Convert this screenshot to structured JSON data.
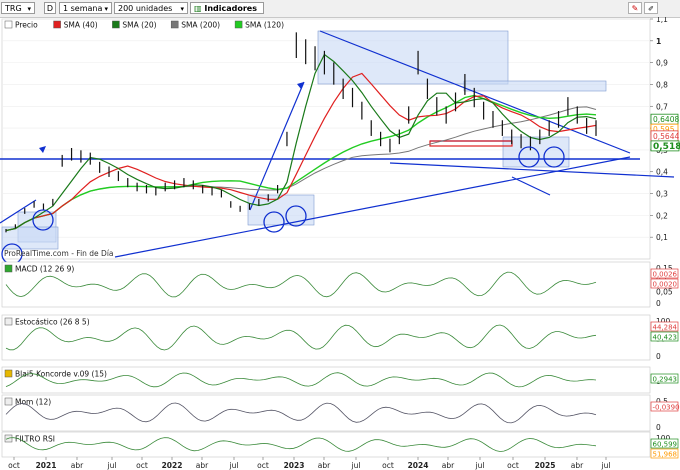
{
  "toolbar": {
    "ticker": "TRG",
    "ticker_icon": "chevron-down-icon",
    "d_button": "D",
    "timeframe": "1 semana",
    "units": "200 unidades",
    "indicators": "Indicadores"
  },
  "colors": {
    "sma40": "#e02020",
    "sma20": "#1a7a1a",
    "sma200": "#777777",
    "sma120": "#22cc22",
    "trend": "#1030d0",
    "box": "#9bb6e8",
    "macd_pos": "#2fa82f",
    "macd_neg": "#d03030",
    "tag_red": "#e04040",
    "tag_orange": "#ff9900",
    "tag_green": "#1e8e1e"
  },
  "chart_data": {
    "type": "line",
    "title": "",
    "price_axis": {
      "min": 0,
      "max": 1.1,
      "ticks": [
        "1,1",
        "1",
        "0,9",
        "0,8",
        "0,7",
        "0,6",
        "0,5",
        "0,4",
        "0,3",
        "0,2",
        "0,1"
      ]
    },
    "price_tags": [
      {
        "label": "0,6408",
        "value": 0.6408,
        "color": "tag_green"
      },
      {
        "label": "0,595",
        "value": 0.595,
        "color": "tag_orange"
      },
      {
        "label": "0,5644",
        "value": 0.5644,
        "color": "tag_red"
      },
      {
        "label": "0,5184",
        "value": 0.5184,
        "color": "tag_green"
      }
    ],
    "legend": [
      {
        "label": "Precio",
        "color": "#ffffff"
      },
      {
        "label": "SMA (40)",
        "color": "#e02020"
      },
      {
        "label": "SMA (20)",
        "color": "#1a7a1a"
      },
      {
        "label": "SMA (200)",
        "color": "#777777"
      },
      {
        "label": "SMA (120)",
        "color": "#22cc22"
      }
    ],
    "x_ticks": [
      "oct",
      "2021",
      "abr",
      "jul",
      "oct",
      "2022",
      "abr",
      "jul",
      "oct",
      "2023",
      "abr",
      "jul",
      "oct",
      "2024",
      "abr",
      "jul",
      "oct",
      "2025",
      "abr",
      "jul"
    ],
    "price_weekly_approx": [
      0.13,
      0.15,
      0.22,
      0.25,
      0.24,
      0.26,
      0.45,
      0.48,
      0.47,
      0.46,
      0.42,
      0.4,
      0.38,
      0.35,
      0.33,
      0.32,
      0.31,
      0.33,
      0.34,
      0.35,
      0.34,
      0.32,
      0.31,
      0.3,
      0.25,
      0.23,
      0.24,
      0.26,
      0.28,
      0.32,
      0.55,
      0.98,
      0.95,
      0.92,
      0.9,
      0.85,
      0.78,
      0.74,
      0.68,
      0.6,
      0.55,
      0.52,
      0.56,
      0.66,
      0.9,
      0.78,
      0.7,
      0.66,
      0.72,
      0.8,
      0.74,
      0.68,
      0.64,
      0.6,
      0.56,
      0.54,
      0.53,
      0.56,
      0.6,
      0.64,
      0.7,
      0.66,
      0.61,
      0.6
    ],
    "source_label": "ProRealTime.com - Fin de Día",
    "panels": [
      {
        "name": "MACD (12 26 9)",
        "ticks": [
          "0,15",
          "0,1",
          "0,05",
          "0"
        ],
        "tags": [
          {
            "label": "0,0026",
            "color": "tag_red"
          },
          {
            "label": "0,0020",
            "color": "tag_red"
          }
        ]
      },
      {
        "name": "Estocástico (26 8 5)",
        "ticks": [
          "100",
          "50",
          "0"
        ],
        "tags": [
          {
            "label": "44,284",
            "color": "tag_red"
          },
          {
            "label": "40,423",
            "color": "tag_green"
          }
        ]
      },
      {
        "name": "Blai5 Koncorde v.09 (15)",
        "ticks": [
          "0"
        ],
        "tags": [
          {
            "label": "0,2943",
            "color": "tag_green"
          }
        ]
      },
      {
        "name": "Mom (12)",
        "ticks": [
          "0,5",
          "0"
        ],
        "tags": [
          {
            "label": "-0,0390",
            "color": "tag_red"
          }
        ]
      },
      {
        "name": "FILTRO RSI",
        "ticks": [
          "100",
          "0"
        ],
        "tags": [
          {
            "label": "60,599",
            "color": "tag_green"
          },
          {
            "label": "51,968",
            "color": "tag_orange"
          }
        ]
      }
    ]
  }
}
